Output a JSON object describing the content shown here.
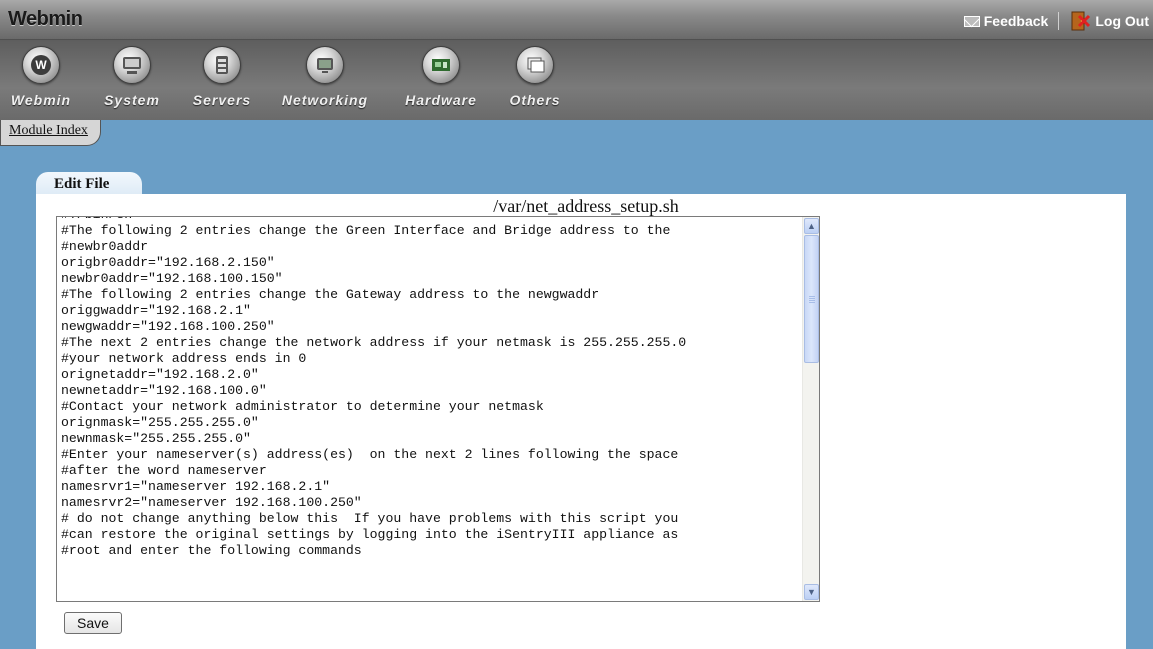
{
  "header": {
    "brand": "Webmin",
    "feedback_label": "Feedback",
    "logout_label": "Log Out"
  },
  "categories": [
    {
      "label": "Webmin",
      "icon": "webmin-icon"
    },
    {
      "label": "System",
      "icon": "system-icon"
    },
    {
      "label": "Servers",
      "icon": "servers-icon"
    },
    {
      "label": "Networking",
      "icon": "networking-icon"
    },
    {
      "label": "Hardware",
      "icon": "hardware-icon"
    },
    {
      "label": "Others",
      "icon": "others-icon"
    }
  ],
  "module_index_label": "Module Index",
  "tab": {
    "label": "Edit File"
  },
  "file": {
    "path": "/var/net_address_setup.sh",
    "content": "#!/bin/sh\n#The following 2 entries change the Green Interface and Bridge address to the\n#newbr0addr\norigbr0addr=\"192.168.2.150\"\nnewbr0addr=\"192.168.100.150\"\n#The following 2 entries change the Gateway address to the newgwaddr\noriggwaddr=\"192.168.2.1\"\nnewgwaddr=\"192.168.100.250\"\n#The next 2 entries change the network address if your netmask is 255.255.255.0\n#your network address ends in 0\norignetaddr=\"192.168.2.0\"\nnewnetaddr=\"192.168.100.0\"\n#Contact your network administrator to determine your netmask\norignmask=\"255.255.255.0\"\nnewnmask=\"255.255.255.0\"\n#Enter your nameserver(s) address(es)  on the next 2 lines following the space\n#after the word nameserver\nnamesrvr1=\"nameserver 192.168.2.1\"\nnamesrvr2=\"nameserver 192.168.100.250\"\n# do not change anything below this  If you have problems with this script you\n#can restore the original settings by logging into the iSentryIII appliance as\n#root and enter the following commands"
  },
  "save_label": "Save",
  "colors": {
    "page_bg": "#6a9ec6",
    "tab_bg": "#dbe9f5"
  }
}
